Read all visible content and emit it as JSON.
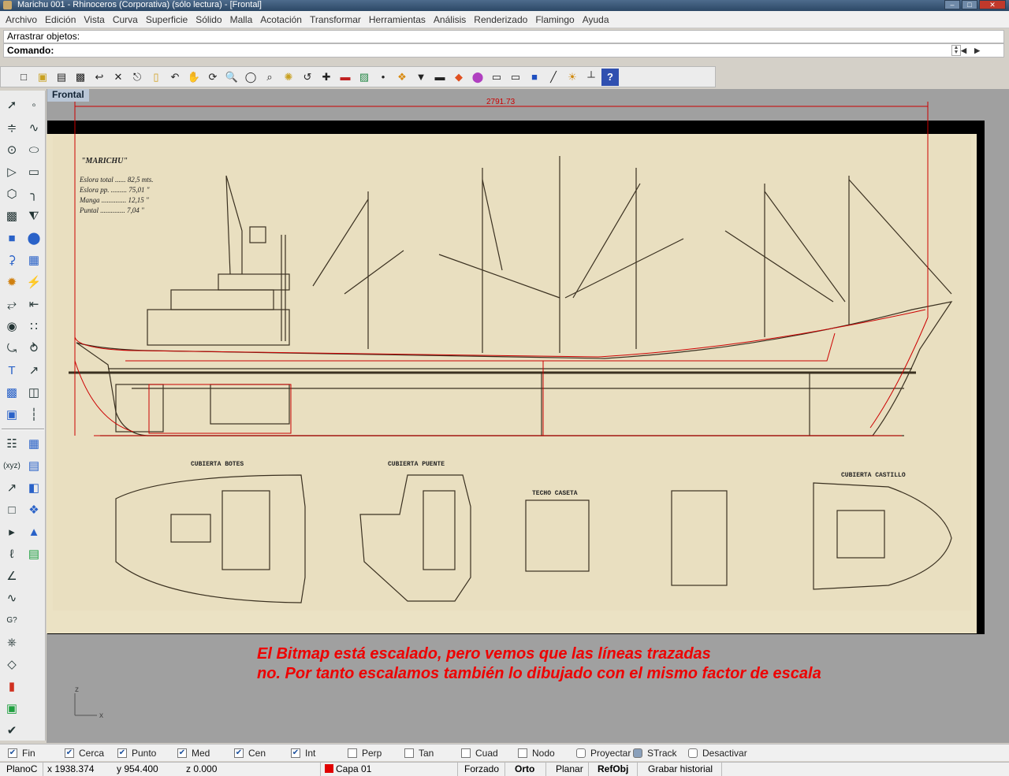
{
  "window": {
    "title": "Marichu 001 - Rhinoceros (Corporativa) (sólo lectura) - [Frontal]"
  },
  "menu": [
    "Archivo",
    "Edición",
    "Vista",
    "Curva",
    "Superficie",
    "Sólido",
    "Malla",
    "Acotación",
    "Transformar",
    "Herramientas",
    "Análisis",
    "Renderizado",
    "Flamingo",
    "Ayuda"
  ],
  "command": {
    "history": "Arrastrar objetos:",
    "prompt": "Comando:"
  },
  "viewport": {
    "name": "Frontal",
    "dimension": "2791.73",
    "bitmap": {
      "ship_name": "\"MARICHU\"",
      "specs": [
        "Eslora total ...... 82,5 mts.",
        "Eslora pp. ......... 75,01 \"",
        "Manga .............. 12,15 \"",
        "Puntal .............. 7,04 \""
      ],
      "deck_labels": [
        "CUBIERTA BOTES",
        "CUBIERTA PUENTE",
        "TECHO CASETA",
        "CUBIERTA CASTILLO"
      ]
    },
    "annotation": [
      "El Bitmap está escalado, pero vemos que las líneas trazadas",
      "no. Por tanto escalamos también lo dibujado con el mismo factor de escala"
    ],
    "axis": {
      "z": "z",
      "x": "x"
    },
    "colors": {
      "trace": "#cc0000",
      "background": "#a0a0a0",
      "paper": "#e9dfc0"
    }
  },
  "osnaps": [
    {
      "label": "Fin",
      "checked": true
    },
    {
      "label": "Cerca",
      "checked": true
    },
    {
      "label": "Punto",
      "checked": true
    },
    {
      "label": "Med",
      "checked": true
    },
    {
      "label": "Cen",
      "checked": true
    },
    {
      "label": "Int",
      "checked": true
    },
    {
      "label": "Perp",
      "checked": false
    },
    {
      "label": "Tan",
      "checked": false
    },
    {
      "label": "Cuad",
      "checked": false
    },
    {
      "label": "Nodo",
      "checked": false
    }
  ],
  "osnap_toggles": [
    "Proyectar",
    "STrack",
    "Desactivar"
  ],
  "status": {
    "cplane": "PlanoC",
    "x": "x 1938.374",
    "y": "y 954.400",
    "z": "z 0.000",
    "layer": "Capa 01",
    "layer_color": "#e00000",
    "forzado": "Forzado",
    "orto": "Orto",
    "planar": "Planar",
    "refobj": "RefObj",
    "history": "Grabar historial"
  }
}
